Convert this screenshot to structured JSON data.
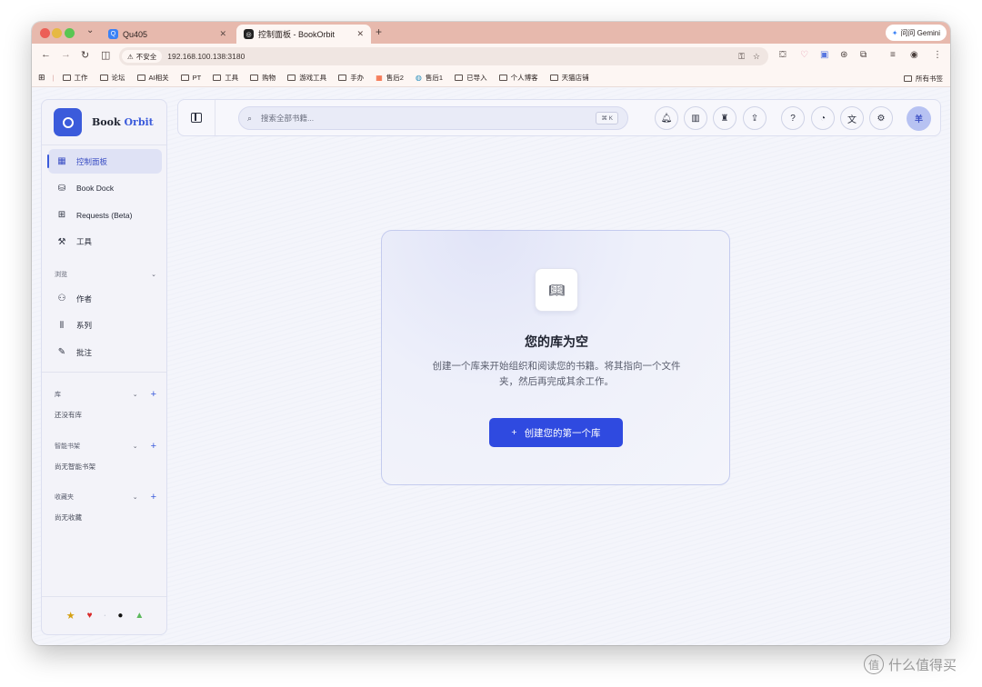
{
  "browser": {
    "tabs": [
      {
        "title": "Qu405",
        "favicon_color": "#3b82f6"
      },
      {
        "title": "控制面板 - BookOrbit",
        "favicon_color": "#222222"
      }
    ],
    "new_tab_label": "+",
    "gemini_label": "问问 Gemini",
    "not_secure_label": "不安全",
    "url": "192.168.100.138:3180",
    "bookmarks": [
      "工作",
      "论坛",
      "AI相关",
      "PT",
      "工具",
      "购物",
      "游戏工具",
      "手办",
      "售后2",
      "售后1",
      "已导入",
      "个人博客",
      "天猫店铺"
    ],
    "all_bookmarks_label": "所有书签"
  },
  "sidebar": {
    "brand_word1": "Book",
    "brand_word2": "Orbit",
    "main_items": [
      {
        "label": "控制面板",
        "icon": "dashboard-icon"
      },
      {
        "label": "Book Dock",
        "icon": "dock-icon"
      },
      {
        "label": "Requests (Beta)",
        "icon": "requests-icon"
      },
      {
        "label": "工具",
        "icon": "wrench-icon"
      }
    ],
    "browse_heading": "浏览",
    "browse_items": [
      {
        "label": "作者",
        "icon": "users-icon"
      },
      {
        "label": "系列",
        "icon": "series-icon"
      },
      {
        "label": "批注",
        "icon": "annotate-icon"
      }
    ],
    "sections": [
      {
        "heading": "库",
        "empty": "还没有库"
      },
      {
        "heading": "智能书架",
        "empty": "尚无智能书架"
      },
      {
        "heading": "收藏夹",
        "empty": "尚无收藏"
      }
    ],
    "footer_icons": [
      "star-icon",
      "heart-icon",
      "apple-icon",
      "android-icon"
    ]
  },
  "topbar": {
    "search_placeholder": "搜索全部书籍...",
    "search_shortcut": "⌘ K",
    "avatar_letter": "羊"
  },
  "empty_state": {
    "title": "您的库为空",
    "description": "创建一个库来开始组织和阅读您的书籍。将其指向一个文件夹，然后再完成其余工作。",
    "button_label": "创建您的第一个库"
  },
  "watermark": "什么值得买",
  "colors": {
    "accent": "#2f4ae0",
    "brand": "#3b5bdb",
    "tabbar": "#e7b9ad"
  }
}
